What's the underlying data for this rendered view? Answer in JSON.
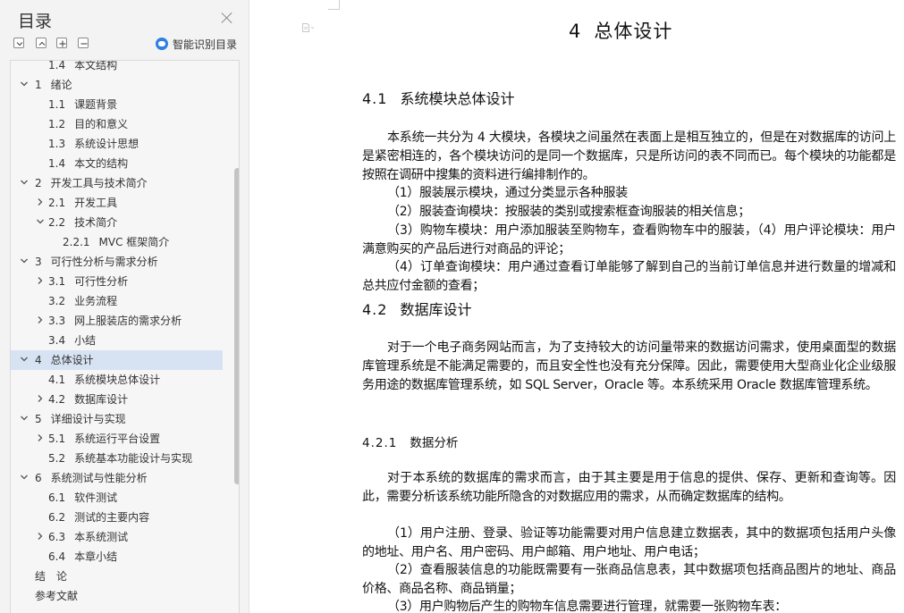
{
  "toc": {
    "title": "目录",
    "smart_label": "智能识别目录",
    "items": [
      {
        "num": "1.4",
        "label": "本文结构",
        "level": 2,
        "chevron": "none"
      },
      {
        "num": "1",
        "label": "绪论",
        "level": 1,
        "chevron": "down"
      },
      {
        "num": "1.1",
        "label": "课题背景",
        "level": 2,
        "chevron": "none"
      },
      {
        "num": "1.2",
        "label": "目的和意义",
        "level": 2,
        "chevron": "none"
      },
      {
        "num": "1.3",
        "label": "系统设计思想",
        "level": 2,
        "chevron": "none"
      },
      {
        "num": "1.4",
        "label": "本文的结构",
        "level": 2,
        "chevron": "none"
      },
      {
        "num": "2",
        "label": "开发工具与技术简介",
        "level": 1,
        "chevron": "down"
      },
      {
        "num": "2.1",
        "label": "开发工具",
        "level": 2,
        "chevron": "right"
      },
      {
        "num": "2.2",
        "label": "技术简介",
        "level": 2,
        "chevron": "down"
      },
      {
        "num": "2.2.1",
        "label": "MVC 框架简介",
        "level": 3,
        "chevron": "none"
      },
      {
        "num": "3",
        "label": "可行性分析与需求分析",
        "level": 1,
        "chevron": "down"
      },
      {
        "num": "3.1",
        "label": "可行性分析",
        "level": 2,
        "chevron": "right"
      },
      {
        "num": "3.2",
        "label": "业务流程",
        "level": 2,
        "chevron": "none"
      },
      {
        "num": "3.3",
        "label": "网上服装店的需求分析",
        "level": 2,
        "chevron": "right"
      },
      {
        "num": "3.4",
        "label": "小结",
        "level": 2,
        "chevron": "none"
      },
      {
        "num": "4",
        "label": "总体设计",
        "level": 1,
        "chevron": "down",
        "selected": true
      },
      {
        "num": "4.1",
        "label": "系统模块总体设计",
        "level": 2,
        "chevron": "none"
      },
      {
        "num": "4.2",
        "label": "数据库设计",
        "level": 2,
        "chevron": "right"
      },
      {
        "num": "5",
        "label": "详细设计与实现",
        "level": 1,
        "chevron": "down"
      },
      {
        "num": "5.1",
        "label": "系统运行平台设置",
        "level": 2,
        "chevron": "right"
      },
      {
        "num": "5.2",
        "label": "系统基本功能设计与实现",
        "level": 2,
        "chevron": "none"
      },
      {
        "num": "6",
        "label": "系统测试与性能分析",
        "level": 1,
        "chevron": "down"
      },
      {
        "num": "6.1",
        "label": "软件测试",
        "level": 2,
        "chevron": "none"
      },
      {
        "num": "6.2",
        "label": "测试的主要内容",
        "level": 2,
        "chevron": "none"
      },
      {
        "num": "6.3",
        "label": "本系统测试",
        "level": 2,
        "chevron": "right"
      },
      {
        "num": "6.4",
        "label": "本章小结",
        "level": 2,
        "chevron": "none"
      },
      {
        "num": "",
        "label": "结　论",
        "level": 0,
        "chevron": "none"
      },
      {
        "num": "",
        "label": "参考文献",
        "level": 0,
        "chevron": "none"
      }
    ]
  },
  "doc": {
    "chapter_num": "4",
    "chapter_title": "总体设计",
    "s41_num": "4.1",
    "s41_title": "系统模块总体设计",
    "p1": "本系统一共分为 4 大模块，各模块之间虽然在表面上是相互独立的，但是在对数据库的访问上是紧密相连的，各个模块访问的是同一个数据库，只是所访问的表不同而已。每个模块的功能都是按照在调研中搜集的资料进行编排制作的。",
    "p2": "（1）服装展示模块，通过分类显示各种服装",
    "p3": "（2）服装查询模块：按服装的类别或搜索框查询服装的相关信息；",
    "p4": "（3）购物车模块：用户添加服装至购物车，查看购物车中的服装，（4）用户评论模块：用户满意购买的产品后进行对商品的评论；",
    "p5": "（4）订单查询模块：用户通过查看订单能够了解到自己的当前订单信息并进行数量的增减和总共应付金额的查看；",
    "s42_num": "4.2",
    "s42_title": "数据库设计",
    "p6": "对于一个电子商务网站而言，为了支持较大的访问量带来的数据访问需求，使用桌面型的数据库管理系统是不能满足需要的，而且安全性也没有充分保障。因此，需要使用大型商业化企业级服务用途的数据库管理系统，如 SQL Server，Oracle 等。本系统采用 Oracle 数据库管理系统。",
    "s421_num": "4.2.1",
    "s421_title": "数据分析",
    "p7": "对于本系统的数据库的需求而言，由于其主要是用于信息的提供、保存、更新和查询等。因此，需要分析该系统功能所隐含的对数据应用的需求，从而确定数据库的结构。",
    "p8": "（1）用户注册、登录、验证等功能需要对用户信息建立数据表，其中的数据项包括用户头像的地址、用户名、用户密码、用户邮箱、用户地址、用户电话；",
    "p9": "（2）查看服装信息的功能既需要有一张商品信息表，其中数据项包括商品图片的地址、商品价格、商品名称、商品销量；",
    "p10": "（3）用户购物后产生的购物车信息需要进行管理，就需要一张购物车表："
  }
}
